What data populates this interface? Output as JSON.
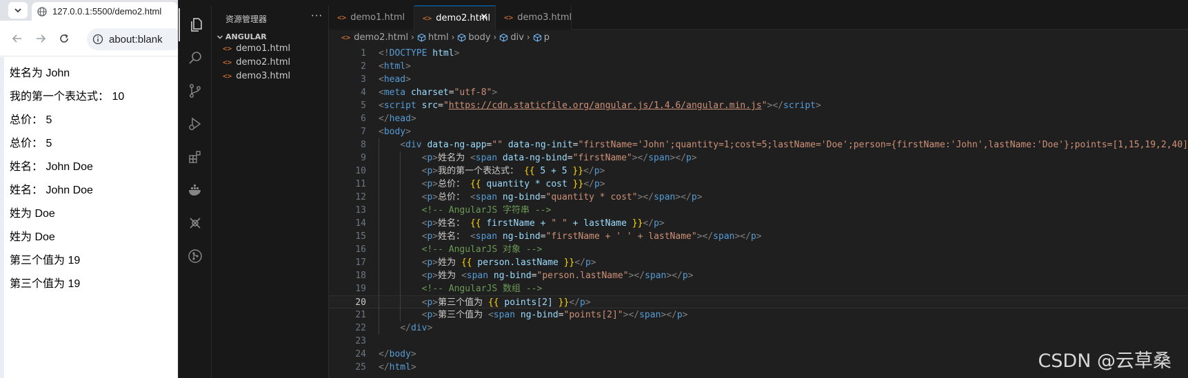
{
  "browser": {
    "tab_title": "127.0.0.1:5500/demo2.html",
    "address": "about:blank",
    "content_lines": [
      "姓名为 John",
      "我的第一个表达式： 10",
      "总价： 5",
      "总价： 5",
      "姓名： John Doe",
      "姓名： John Doe",
      "姓为 Doe",
      "姓为 Doe",
      "第三个值为 19",
      "第三个值为 19"
    ]
  },
  "vscode": {
    "sidebar_title": "资源管理器",
    "sidebar_more": "···",
    "folder": "ANGULAR",
    "files": [
      "demo1.html",
      "demo2.html",
      "demo3.html"
    ],
    "tabs": [
      {
        "name": "demo1.html",
        "active": false
      },
      {
        "name": "demo2.html",
        "active": true
      },
      {
        "name": "demo3.html",
        "active": false
      }
    ],
    "tab_close": "✕",
    "breadcrumbs": [
      "demo2.html",
      "html",
      "body",
      "div",
      "p"
    ],
    "current_line": 20,
    "code": [
      {
        "n": "1",
        "indent": 0,
        "tokens": [
          [
            "tag",
            "<!"
          ],
          [
            "tname",
            "DOCTYPE"
          ],
          [
            "plain",
            " "
          ],
          [
            "attr",
            "html"
          ],
          [
            "tag",
            ">"
          ]
        ]
      },
      {
        "n": "2",
        "indent": 0,
        "tokens": [
          [
            "tag",
            "<"
          ],
          [
            "tname",
            "html"
          ],
          [
            "tag",
            ">"
          ]
        ]
      },
      {
        "n": "3",
        "indent": 0,
        "tokens": [
          [
            "tag",
            "<"
          ],
          [
            "tname",
            "head"
          ],
          [
            "tag",
            ">"
          ]
        ]
      },
      {
        "n": "4",
        "indent": 0,
        "tokens": [
          [
            "tag",
            "<"
          ],
          [
            "tname",
            "meta"
          ],
          [
            "plain",
            " "
          ],
          [
            "attr",
            "charset"
          ],
          [
            "plain",
            "="
          ],
          [
            "str",
            "\"utf-8\""
          ],
          [
            "tag",
            ">"
          ]
        ]
      },
      {
        "n": "5",
        "indent": 0,
        "tokens": [
          [
            "tag",
            "<"
          ],
          [
            "tname",
            "script"
          ],
          [
            "plain",
            " "
          ],
          [
            "attr",
            "src"
          ],
          [
            "plain",
            "="
          ],
          [
            "str",
            "\""
          ],
          [
            "link",
            "https://cdn.staticfile.org/angular.js/1.4.6/angular.min.js"
          ],
          [
            "str",
            "\""
          ],
          [
            "tag",
            "></"
          ],
          [
            "tname",
            "script"
          ],
          [
            "tag",
            ">"
          ]
        ]
      },
      {
        "n": "6",
        "indent": 0,
        "tokens": [
          [
            "tag",
            "</"
          ],
          [
            "tname",
            "head"
          ],
          [
            "tag",
            ">"
          ]
        ]
      },
      {
        "n": "7",
        "indent": 0,
        "tokens": [
          [
            "tag",
            "<"
          ],
          [
            "tname",
            "body"
          ],
          [
            "tag",
            ">"
          ]
        ]
      },
      {
        "n": "8",
        "indent": 1,
        "tokens": [
          [
            "tag",
            "<"
          ],
          [
            "tname",
            "div"
          ],
          [
            "plain",
            " "
          ],
          [
            "attr",
            "data-ng-app"
          ],
          [
            "plain",
            "="
          ],
          [
            "str",
            "\"\""
          ],
          [
            "plain",
            " "
          ],
          [
            "attr",
            "data-ng-init"
          ],
          [
            "plain",
            "="
          ],
          [
            "str",
            "\"firstName='John';quantity=1;cost=5;lastName='Doe';person={firstName:'John',lastName:'Doe'};points=[1,15,19,2,40]\""
          ],
          [
            "tag",
            ">"
          ]
        ]
      },
      {
        "n": "9",
        "indent": 2,
        "tokens": [
          [
            "tag",
            "<"
          ],
          [
            "tname",
            "p"
          ],
          [
            "tag",
            ">"
          ],
          [
            "text",
            "姓名为 "
          ],
          [
            "tag",
            "<"
          ],
          [
            "tname",
            "span"
          ],
          [
            "plain",
            " "
          ],
          [
            "attr",
            "data-ng-bind"
          ],
          [
            "plain",
            "="
          ],
          [
            "str",
            "\"firstName\""
          ],
          [
            "tag",
            "></"
          ],
          [
            "tname",
            "span"
          ],
          [
            "tag",
            "></"
          ],
          [
            "tname",
            "p"
          ],
          [
            "tag",
            ">"
          ]
        ]
      },
      {
        "n": "10",
        "indent": 2,
        "tokens": [
          [
            "tag",
            "<"
          ],
          [
            "tname",
            "p"
          ],
          [
            "tag",
            ">"
          ],
          [
            "text",
            "我的第一个表达式： "
          ],
          [
            "brace",
            "{{"
          ],
          [
            "expr",
            " 5 + 5 "
          ],
          [
            "brace",
            "}}"
          ],
          [
            "tag",
            "</"
          ],
          [
            "tname",
            "p"
          ],
          [
            "tag",
            ">"
          ]
        ]
      },
      {
        "n": "11",
        "indent": 2,
        "tokens": [
          [
            "tag",
            "<"
          ],
          [
            "tname",
            "p"
          ],
          [
            "tag",
            ">"
          ],
          [
            "text",
            "总价： "
          ],
          [
            "brace",
            "{{"
          ],
          [
            "expr",
            " quantity * cost "
          ],
          [
            "brace",
            "}}"
          ],
          [
            "tag",
            "</"
          ],
          [
            "tname",
            "p"
          ],
          [
            "tag",
            ">"
          ]
        ]
      },
      {
        "n": "12",
        "indent": 2,
        "tokens": [
          [
            "tag",
            "<"
          ],
          [
            "tname",
            "p"
          ],
          [
            "tag",
            ">"
          ],
          [
            "text",
            "总价： "
          ],
          [
            "tag",
            "<"
          ],
          [
            "tname",
            "span"
          ],
          [
            "plain",
            " "
          ],
          [
            "attr",
            "ng-bind"
          ],
          [
            "plain",
            "="
          ],
          [
            "str",
            "\"quantity * cost\""
          ],
          [
            "tag",
            "></"
          ],
          [
            "tname",
            "span"
          ],
          [
            "tag",
            "></"
          ],
          [
            "tname",
            "p"
          ],
          [
            "tag",
            ">"
          ]
        ]
      },
      {
        "n": "13",
        "indent": 2,
        "tokens": [
          [
            "com",
            "<!-- AngularJS 字符串 -->"
          ]
        ]
      },
      {
        "n": "14",
        "indent": 2,
        "tokens": [
          [
            "tag",
            "<"
          ],
          [
            "tname",
            "p"
          ],
          [
            "tag",
            ">"
          ],
          [
            "text",
            "姓名： "
          ],
          [
            "brace",
            "{{"
          ],
          [
            "expr",
            " firstName + "
          ],
          [
            "str",
            "\" \""
          ],
          [
            "expr",
            " + lastName "
          ],
          [
            "brace",
            "}}"
          ],
          [
            "tag",
            "</"
          ],
          [
            "tname",
            "p"
          ],
          [
            "tag",
            ">"
          ]
        ]
      },
      {
        "n": "15",
        "indent": 2,
        "tokens": [
          [
            "tag",
            "<"
          ],
          [
            "tname",
            "p"
          ],
          [
            "tag",
            ">"
          ],
          [
            "text",
            "姓名： "
          ],
          [
            "tag",
            "<"
          ],
          [
            "tname",
            "span"
          ],
          [
            "plain",
            " "
          ],
          [
            "attr",
            "ng-bind"
          ],
          [
            "plain",
            "="
          ],
          [
            "str",
            "\"firstName + ' ' + lastName\""
          ],
          [
            "tag",
            "></"
          ],
          [
            "tname",
            "span"
          ],
          [
            "tag",
            "></"
          ],
          [
            "tname",
            "p"
          ],
          [
            "tag",
            ">"
          ]
        ]
      },
      {
        "n": "16",
        "indent": 2,
        "tokens": [
          [
            "com",
            "<!-- AngularJS 对象 -->"
          ]
        ]
      },
      {
        "n": "17",
        "indent": 2,
        "tokens": [
          [
            "tag",
            "<"
          ],
          [
            "tname",
            "p"
          ],
          [
            "tag",
            ">"
          ],
          [
            "text",
            "姓为 "
          ],
          [
            "brace",
            "{{"
          ],
          [
            "expr",
            " person.lastName "
          ],
          [
            "brace",
            "}}"
          ],
          [
            "tag",
            "</"
          ],
          [
            "tname",
            "p"
          ],
          [
            "tag",
            ">"
          ]
        ]
      },
      {
        "n": "18",
        "indent": 2,
        "tokens": [
          [
            "tag",
            "<"
          ],
          [
            "tname",
            "p"
          ],
          [
            "tag",
            ">"
          ],
          [
            "text",
            "姓为 "
          ],
          [
            "tag",
            "<"
          ],
          [
            "tname",
            "span"
          ],
          [
            "plain",
            " "
          ],
          [
            "attr",
            "ng-bind"
          ],
          [
            "plain",
            "="
          ],
          [
            "str",
            "\"person.lastName\""
          ],
          [
            "tag",
            "></"
          ],
          [
            "tname",
            "span"
          ],
          [
            "tag",
            "></"
          ],
          [
            "tname",
            "p"
          ],
          [
            "tag",
            ">"
          ]
        ]
      },
      {
        "n": "19",
        "indent": 2,
        "tokens": [
          [
            "com",
            "<!-- AngularJS 数组 -->"
          ]
        ]
      },
      {
        "n": "20",
        "indent": 2,
        "tokens": [
          [
            "tag",
            "<"
          ],
          [
            "tname",
            "p"
          ],
          [
            "tag",
            ">"
          ],
          [
            "text",
            "第三个值为 "
          ],
          [
            "brace",
            "{{"
          ],
          [
            "expr",
            " points[2] "
          ],
          [
            "brace",
            "}}"
          ],
          [
            "tag",
            "</"
          ],
          [
            "tname",
            "p"
          ],
          [
            "tag",
            ">"
          ]
        ]
      },
      {
        "n": "21",
        "indent": 2,
        "tokens": [
          [
            "tag",
            "<"
          ],
          [
            "tname",
            "p"
          ],
          [
            "tag",
            ">"
          ],
          [
            "text",
            "第三个值为 "
          ],
          [
            "tag",
            "<"
          ],
          [
            "tname",
            "span"
          ],
          [
            "plain",
            " "
          ],
          [
            "attr",
            "ng-bind"
          ],
          [
            "plain",
            "="
          ],
          [
            "str",
            "\"points[2]\""
          ],
          [
            "tag",
            "></"
          ],
          [
            "tname",
            "span"
          ],
          [
            "tag",
            "></"
          ],
          [
            "tname",
            "p"
          ],
          [
            "tag",
            ">"
          ]
        ]
      },
      {
        "n": "22",
        "indent": 1,
        "tokens": [
          [
            "tag",
            "</"
          ],
          [
            "tname",
            "div"
          ],
          [
            "tag",
            ">"
          ]
        ]
      },
      {
        "n": "23",
        "indent": 0,
        "tokens": []
      },
      {
        "n": "24",
        "indent": 0,
        "tokens": [
          [
            "tag",
            "</"
          ],
          [
            "tname",
            "body"
          ],
          [
            "tag",
            ">"
          ]
        ]
      },
      {
        "n": "25",
        "indent": 0,
        "tokens": [
          [
            "tag",
            "</"
          ],
          [
            "tname",
            "html"
          ],
          [
            "tag",
            ">"
          ]
        ]
      }
    ]
  },
  "watermark": "CSDN @云草桑",
  "colors": {
    "accent": "#0078d4",
    "html_icon": "#e37933",
    "editor_bg": "#1f1f1f"
  }
}
